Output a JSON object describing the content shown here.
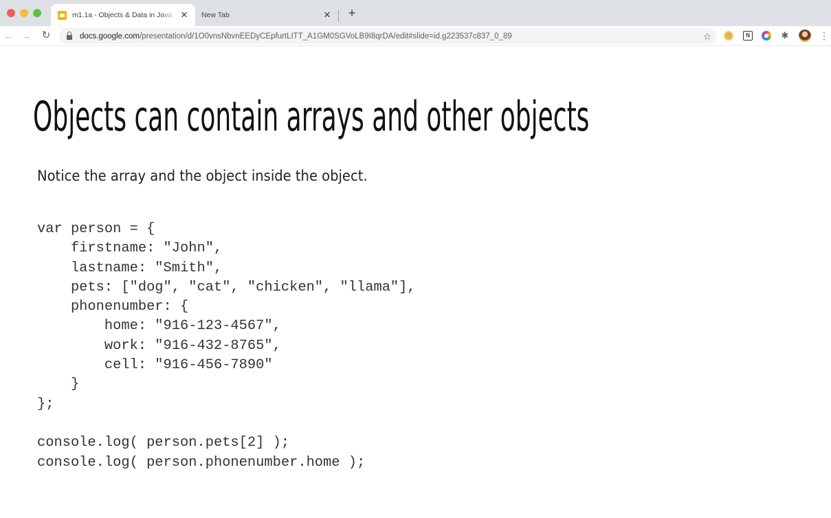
{
  "browser": {
    "tabs": [
      {
        "title": "m1.1a - Objects & Data in Java",
        "active": true
      },
      {
        "title": "New Tab",
        "active": false
      }
    ],
    "close_glyph": "✕",
    "new_tab_glyph": "+",
    "url": {
      "host": "docs.google.com",
      "path": "/presentation/d/1O0vnsNbvnEEDyCEpfurtLITT_A1GM0SGVoLB9I8qrDA/edit#slide=id.g223537c837_0_89"
    },
    "extensions": [
      "coin-extension-icon",
      "notion-icon",
      "color-picker-icon",
      "puzzle-icon",
      "profile-avatar"
    ],
    "notion_letter": "N"
  },
  "slide": {
    "title": "Objects can contain arrays and other objects",
    "subtitle": "Notice the array and the object inside the object.",
    "code_lines": [
      "var person = {",
      "    firstname: \"John\",",
      "    lastname: \"Smith\",",
      "    pets: [\"dog\", \"cat\", \"chicken\", \"llama\"],",
      "    phonenumber: {",
      "        home: \"916-123-4567\",",
      "        work: \"916-432-8765\",",
      "        cell: \"916-456-7890\"",
      "    }",
      "};",
      "",
      "console.log( person.pets[2] );",
      "console.log( person.phonenumber.home );"
    ]
  }
}
